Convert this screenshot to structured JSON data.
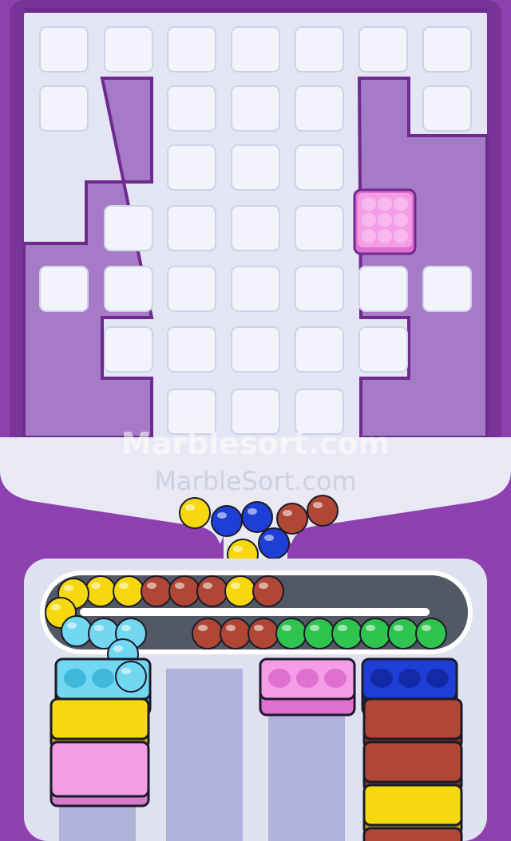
{
  "watermarks": {
    "primary": "Marblesort.com",
    "secondary": "MarbleSort.com"
  },
  "colors": {
    "frame": "#8e3fb0",
    "frame_dark": "#6e2a8e",
    "board": "#e6e7f5",
    "tile": "#f3f4fb",
    "wall": "#a57ac6",
    "track": "#545a66",
    "yellow": "#f6d80f",
    "blue": "#1e3fd6",
    "brown": "#b04734",
    "green": "#2fc44d",
    "cyan": "#72d8f2",
    "pink": "#f49ce6",
    "slot": "#aeb2d8"
  },
  "board": {
    "grid_rows": 7,
    "grid_cols": 7,
    "tile_rows": [
      [
        1,
        1,
        1,
        1,
        1,
        1,
        1
      ],
      [
        1,
        0,
        1,
        1,
        1,
        0,
        1
      ],
      [
        0,
        0,
        1,
        1,
        1,
        0,
        0
      ],
      [
        0,
        1,
        1,
        1,
        1,
        0,
        0
      ],
      [
        1,
        1,
        1,
        1,
        1,
        1,
        1
      ],
      [
        0,
        1,
        1,
        1,
        1,
        1,
        0
      ],
      [
        0,
        0,
        1,
        1,
        1,
        0,
        0
      ]
    ],
    "pink_block": {
      "row": 3,
      "col": 5,
      "color": "pink",
      "marble_count": 9
    }
  },
  "funnel_marbles": [
    "yellow",
    "blue",
    "blue",
    "brown",
    "brown",
    "yellow",
    "blue"
  ],
  "conveyor": {
    "top_row": [
      "yellow",
      "yellow",
      "brown",
      "brown",
      "brown",
      "yellow",
      "brown"
    ],
    "bottom_row": [
      "brown",
      "brown",
      "brown",
      "green",
      "green",
      "green",
      "green",
      "green",
      "green"
    ],
    "left_bend": [
      "yellow",
      "yellow",
      "cyan",
      "cyan",
      "cyan",
      "cyan"
    ]
  },
  "trays": [
    {
      "name": "cyan-tray",
      "color": "cyan",
      "slots": 3,
      "filled": 1
    },
    {
      "name": "pink-tray",
      "color": "pink",
      "slots": 3,
      "filled": 0
    },
    {
      "name": "blue-tray",
      "color": "blue",
      "slots": 3,
      "filled": 0
    }
  ],
  "stacks": {
    "left": [
      "yellow",
      "pink"
    ],
    "right": [
      "brown",
      "brown",
      "yellow",
      "brown"
    ]
  }
}
